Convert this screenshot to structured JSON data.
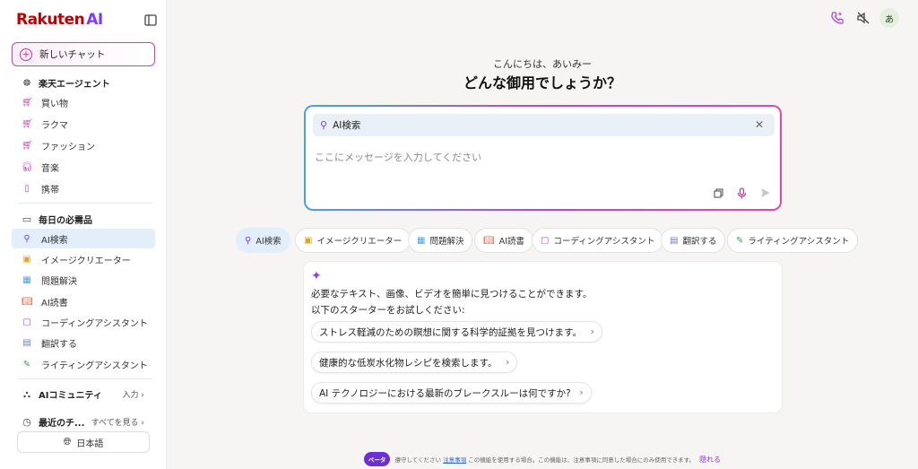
{
  "brand": {
    "logo_main": "Rakuten",
    "logo_ai": "AI"
  },
  "sidebar": {
    "new_chat": "新しいチャット",
    "agent_heading": "楽天エージェント",
    "agent_items": [
      {
        "label": "買い物"
      },
      {
        "label": "ラクマ"
      },
      {
        "label": "ファッション"
      },
      {
        "label": "音楽"
      },
      {
        "label": "携帯"
      }
    ],
    "daily_heading": "毎日の必需品",
    "daily_items": [
      {
        "label": "AI検索"
      },
      {
        "label": "イメージクリエーター"
      },
      {
        "label": "問題解決"
      },
      {
        "label": "AI読書"
      },
      {
        "label": "コーディングアシスタント"
      },
      {
        "label": "翻訳する"
      },
      {
        "label": "ライティングアシスタント"
      }
    ],
    "community_heading": "AIコミュニティ",
    "community_join": "入力",
    "recent_heading": "最近のチ...",
    "recent_more": "すべてを見る",
    "language": "日本語"
  },
  "user": {
    "avatar": "あ"
  },
  "main": {
    "greeting": "こんにちは、あいみー",
    "question": "どんな御用でしょうか？",
    "active_tool": "AI検索",
    "input_placeholder": "ここにメッセージを入力してください"
  },
  "chips": [
    {
      "label": "AI検索"
    },
    {
      "label": "イメージクリエーター"
    },
    {
      "label": "問題解決"
    },
    {
      "label": "AI読書"
    },
    {
      "label": "コーディングアシスタント"
    },
    {
      "label": "翻訳する"
    },
    {
      "label": "ライティングアシスタント"
    }
  ],
  "card": {
    "line1": "必要なテキスト、画像、ビデオを簡単に見つけることができます。",
    "line2": "以下のスターターをお試しください:",
    "suggestions": [
      "ストレス軽減のための瞑想に関する科学的証拠を見つけます。",
      "健康的な低炭水化物レシピを検索します。",
      "AI テクノロジーにおける最新のブレークスルーは何ですか?"
    ]
  },
  "footer": {
    "beta": "ベータ",
    "pre": "遵守してください",
    "link": "注意事項",
    "post": "この機能を使用する場合。この機能は、注意事項に同意した場合にのみ使用できます。",
    "hide": "隠れる"
  },
  "colors": {
    "brand_red": "#bf0000",
    "accent_purple": "#7a3cff",
    "accent_pink": "#d63db1",
    "active_bg": "#e3eefb"
  }
}
